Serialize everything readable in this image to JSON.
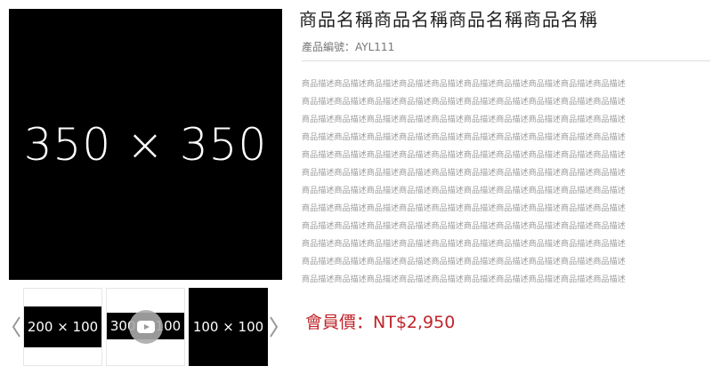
{
  "main_image": {
    "label": "350 × 350"
  },
  "gallery": {
    "thumbnails": [
      {
        "label": "200 × 100"
      },
      {
        "label": "300 × 100",
        "has_video": true
      },
      {
        "label": "100 × 100"
      }
    ]
  },
  "product": {
    "title": "商品名稱商品名稱商品名稱商品名稱",
    "code_label": "產品編號：AYL111",
    "description_lines": [
      "商品描述商品描述商品描述商品描述商品描述商品描述商品描述商品描述商品描述商品描述",
      "商品描述商品描述商品描述商品描述商品描述商品描述商品描述商品描述商品描述商品描述",
      "商品描述商品描述商品描述商品描述商品描述商品描述商品描述商品描述商品描述商品描述",
      "商品描述商品描述商品描述商品描述商品描述商品描述商品描述商品描述商品描述商品描述",
      "商品描述商品描述商品描述商品描述商品描述商品描述商品描述商品描述商品描述商品描述",
      "商品描述商品描述商品描述商品描述商品描述商品描述商品描述商品描述商品描述商品描述",
      "商品描述商品描述商品描述商品描述商品描述商品描述商品描述商品描述商品描述商品描述",
      "商品描述商品描述商品描述商品描述商品描述商品描述商品描述商品描述商品描述商品描述",
      "商品描述商品描述商品描述商品描述商品描述商品描述商品描述商品描述商品描述商品描述",
      "商品描述商品描述商品描述商品描述商品描述商品描述商品描述商品描述商品描述商品描述",
      "商品描述商品描述商品描述商品描述商品描述商品描述商品描述商品描述商品描述商品描述",
      "商品描述商品描述商品描述商品描述商品描述商品描述商品描述商品描述商品描述商品描述"
    ],
    "price_label": "會員價：NT$2,950"
  },
  "colors": {
    "price": "#c0242a",
    "image_bg": "#000000",
    "muted_text": "#9a9a9a"
  }
}
